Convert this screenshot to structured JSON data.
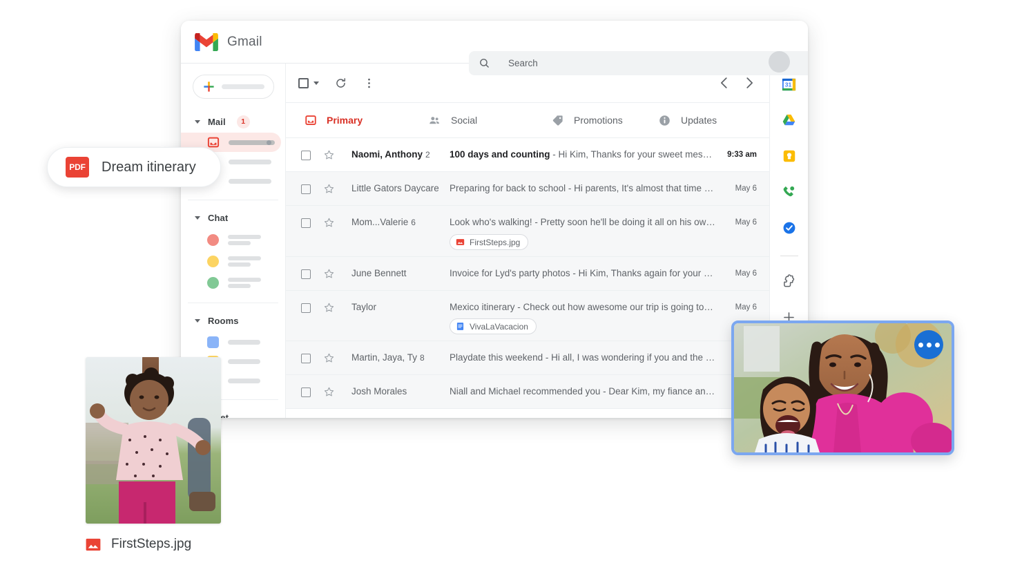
{
  "app": {
    "name": "Gmail",
    "logo_icon": "gmail-logo-icon",
    "avatar_icon": "user-avatar"
  },
  "search": {
    "placeholder": "Search",
    "value": "",
    "search_icon": "search-icon",
    "options_icon": "chevron-down-icon"
  },
  "compose": {
    "label": "",
    "plus_icon": "plus-icon"
  },
  "sidebar": {
    "sections": [
      {
        "title": "Mail",
        "badge": "1",
        "caret_icon": "caret-down-icon",
        "items": [
          {
            "icon": "inbox-icon",
            "label": "",
            "active": true,
            "dot": true
          },
          {
            "icon": "star-icon",
            "label": "",
            "active": false,
            "dot": false
          },
          {
            "icon": "placeholder-icon",
            "label": "",
            "active": false,
            "dot": false
          }
        ]
      },
      {
        "title": "Chat",
        "badge": "",
        "caret_icon": "caret-down-icon",
        "items": [
          {
            "avatar_color": "#f28b82"
          },
          {
            "avatar_color": "#fcd462"
          },
          {
            "avatar_color": "#81c995"
          }
        ]
      },
      {
        "title": "Rooms",
        "badge": "",
        "caret_icon": "caret-down-icon",
        "items": [
          {
            "avatar_color": "#8ab4f8"
          },
          {
            "avatar_color": "#fcd462"
          },
          {
            "avatar_color": "#a8d5a2"
          }
        ]
      },
      {
        "title": "Meet",
        "badge": "",
        "caret_icon": "caret-down-icon",
        "items": [
          {
            "icon": "new-meeting-icon"
          },
          {
            "icon": "calendar-icon"
          }
        ]
      }
    ]
  },
  "toolbar": {
    "select_all_icon": "checkbox-icon",
    "select_all_caret_icon": "caret-down-icon",
    "refresh_icon": "refresh-icon",
    "more_icon": "more-vertical-icon",
    "prev_icon": "chevron-left-icon",
    "next_icon": "chevron-right-icon"
  },
  "tabs": [
    {
      "label": "Primary",
      "icon": "inbox-icon",
      "active": true
    },
    {
      "label": "Social",
      "icon": "people-icon",
      "active": false
    },
    {
      "label": "Promotions",
      "icon": "tag-icon",
      "active": false
    },
    {
      "label": "Updates",
      "icon": "info-icon",
      "active": false
    }
  ],
  "emails": [
    {
      "sender": "Naomi, Anthony",
      "count": "2",
      "subject": "100 days and counting",
      "snippet": " - Hi Kim, Thanks for your sweet message...",
      "date": "9:33 am",
      "unread": true,
      "attachment": null
    },
    {
      "sender": "Little Gators Daycare",
      "count": "",
      "subject": "Preparing for back to school",
      "snippet": " - Hi parents, It's almost that time again...",
      "date": "May 6",
      "unread": false,
      "attachment": null
    },
    {
      "sender": "Mom...Valerie",
      "count": "6",
      "subject": "Look who's walking!",
      "snippet": " - Pretty soon he'll be doing it all on his own 🥰 ...",
      "date": "May 6",
      "unread": false,
      "attachment": {
        "name": "FirstSteps.jpg",
        "icon": "image-file-icon"
      }
    },
    {
      "sender": "June Bennett",
      "count": "",
      "subject": "Invoice for Lyd's party photos",
      "snippet": " - Hi Kim, Thanks again for your amazing...",
      "date": "May 6",
      "unread": false,
      "attachment": null
    },
    {
      "sender": "Taylor",
      "count": "",
      "subject": "Mexico itinerary",
      "snippet": " - Check out how awesome our trip is going to be...",
      "date": "May 6",
      "unread": false,
      "attachment": {
        "name": "VivaLaVacacion",
        "icon": "google-docs-icon"
      }
    },
    {
      "sender": "Martin, Jaya, Ty",
      "count": "8",
      "subject": "Playdate this weekend",
      "snippet": " - Hi all, I was wondering if you and the kids...",
      "date": "",
      "unread": false,
      "attachment": null
    },
    {
      "sender": "Josh Morales",
      "count": "",
      "subject": "Niall and Michael recommended you ",
      "snippet": " - Dear Kim, my fiance and ...",
      "date": "",
      "unread": false,
      "attachment": null
    }
  ],
  "right_rail": [
    {
      "icon": "google-calendar-icon",
      "label": "31"
    },
    {
      "icon": "google-drive-icon",
      "label": ""
    },
    {
      "icon": "google-keep-icon",
      "label": ""
    },
    {
      "icon": "google-voice-icon",
      "label": ""
    },
    {
      "icon": "google-tasks-icon",
      "label": ""
    },
    {
      "icon": "addons-puzzle-icon",
      "label": ""
    },
    {
      "icon": "plus-icon",
      "label": ""
    }
  ],
  "floating": {
    "pdf_chip": {
      "badge_text": "PDF",
      "label": "Dream itinerary",
      "badge_color": "#ea4335"
    },
    "photo_caption": {
      "filename": "FirstSteps.jpg",
      "icon": "image-file-icon"
    },
    "video_call": {
      "border_color": "#7ba7f0",
      "menu_icon": "more-horizontal-icon"
    }
  }
}
